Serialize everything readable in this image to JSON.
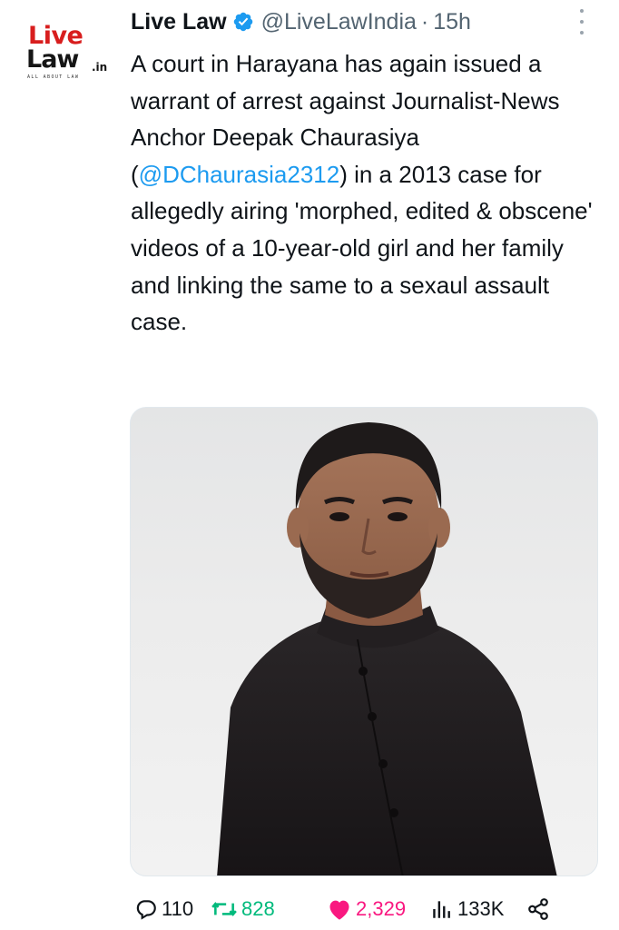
{
  "author": {
    "name": "Live Law",
    "handle": "@LiveLawIndia",
    "separator": "·",
    "time": "15h"
  },
  "logo": {
    "line1": "Live",
    "line2": "Law",
    "suffix": ".in",
    "tagline": "ALL ABOUT LAW"
  },
  "tweet": {
    "text_before": "A court in Harayana has again issued a warrant of arrest against Journalist-News Anchor Deepak Chaurasiya (",
    "mention": "@DChaurasia2312",
    "text_after": ") in a 2013 case for allegedly airing 'morphed, edited & obscene' videos of a 10-year-old girl and her family and linking the same to a sexaul assault case."
  },
  "media": {
    "description_icon": "photo-portrait"
  },
  "stats": {
    "replies": "110",
    "retweets": "828",
    "likes": "2,329",
    "views": "133K"
  },
  "colors": {
    "text": "#0f1419",
    "secondary": "#536471",
    "link": "#1d9bf0",
    "retweet": "#00ba7c",
    "like": "#f91880",
    "logo_red": "#d81e1e"
  }
}
